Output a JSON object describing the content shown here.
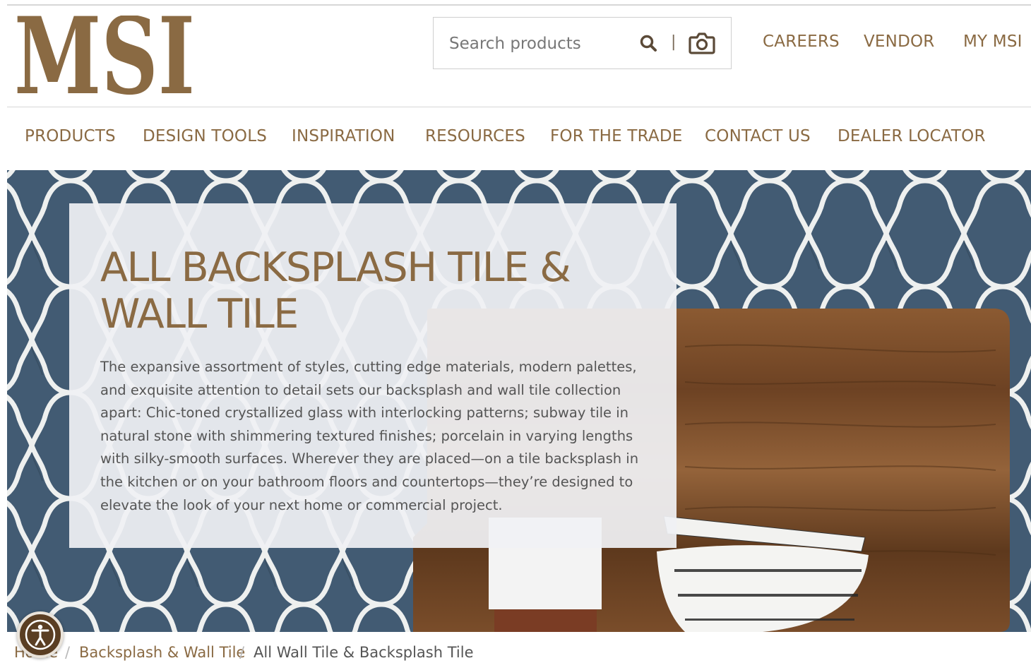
{
  "brand": {
    "logo_text": "MSI",
    "accent_color": "#8a6a43"
  },
  "search": {
    "placeholder": "Search products",
    "separator": "|"
  },
  "utility_nav": [
    {
      "label": "CAREERS"
    },
    {
      "label": "VENDOR"
    },
    {
      "label": "MY MSI"
    }
  ],
  "main_nav": [
    {
      "label": "PRODUCTS"
    },
    {
      "label": "DESIGN TOOLS"
    },
    {
      "label": "INSPIRATION"
    },
    {
      "label": "RESOURCES"
    },
    {
      "label": "FOR THE TRADE"
    },
    {
      "label": "CONTACT US"
    },
    {
      "label": "DEALER LOCATOR"
    }
  ],
  "hero": {
    "title": "ALL BACKSPLASH TILE & WALL TILE",
    "description": "The expansive assortment of styles, cutting edge materials, modern palettes, and exquisite attention to detail sets our backsplash and wall tile collection apart: Chic-toned crystallized glass with interlocking patterns; subway tile in natural stone with shimmering textured finishes; porcelain in varying lengths with silky-smooth surfaces. Wherever they are placed—on a tile backsplash in the kitchen or on your bathroom floors and countertops—they’re designed to elevate the look of your next home or commercial project."
  },
  "breadcrumb": {
    "items": [
      {
        "label": "Home"
      },
      {
        "label": "Backsplash & Wall Tile"
      }
    ],
    "current": "All Wall Tile & Backsplash Tile",
    "separator": "/"
  },
  "accessibility": {
    "icon": "accessibility-icon"
  }
}
